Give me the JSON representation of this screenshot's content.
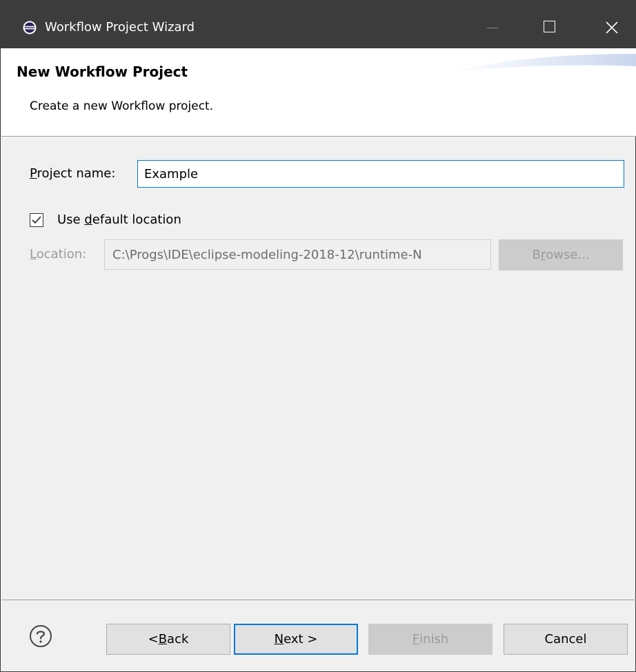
{
  "window": {
    "title": "Workflow Project Wizard"
  },
  "banner": {
    "title": "New Workflow Project",
    "description": "Create a new Workflow project."
  },
  "form": {
    "project_name": {
      "label_accel": "P",
      "label_rest": "roject name:",
      "value": "Example"
    },
    "use_default_location": {
      "label_pre": "Use ",
      "label_accel": "d",
      "label_rest": "efault location",
      "checked": true
    },
    "location": {
      "label_accel": "L",
      "label_rest": "ocation:",
      "value": "C:\\Progs\\IDE\\eclipse-modeling-2018-12\\runtime-N"
    },
    "browse": {
      "label_pre": "B",
      "label_accel": "r",
      "label_rest": "owse..."
    }
  },
  "buttons": {
    "back": {
      "label_pre": "< ",
      "label_accel": "B",
      "label_rest": "ack"
    },
    "next": {
      "label_accel": "N",
      "label_rest": "ext >"
    },
    "finish": {
      "label_accel": "F",
      "label_rest": "inish"
    },
    "cancel": {
      "label": "Cancel"
    }
  },
  "icons": {
    "app": "eclipse-icon",
    "help": "help-icon",
    "checkbox_check": "checkmark-icon"
  },
  "colors": {
    "titlebar": "#3c3c3c",
    "focus_border": "#0078d7",
    "disabled_button": "#cccccc"
  }
}
